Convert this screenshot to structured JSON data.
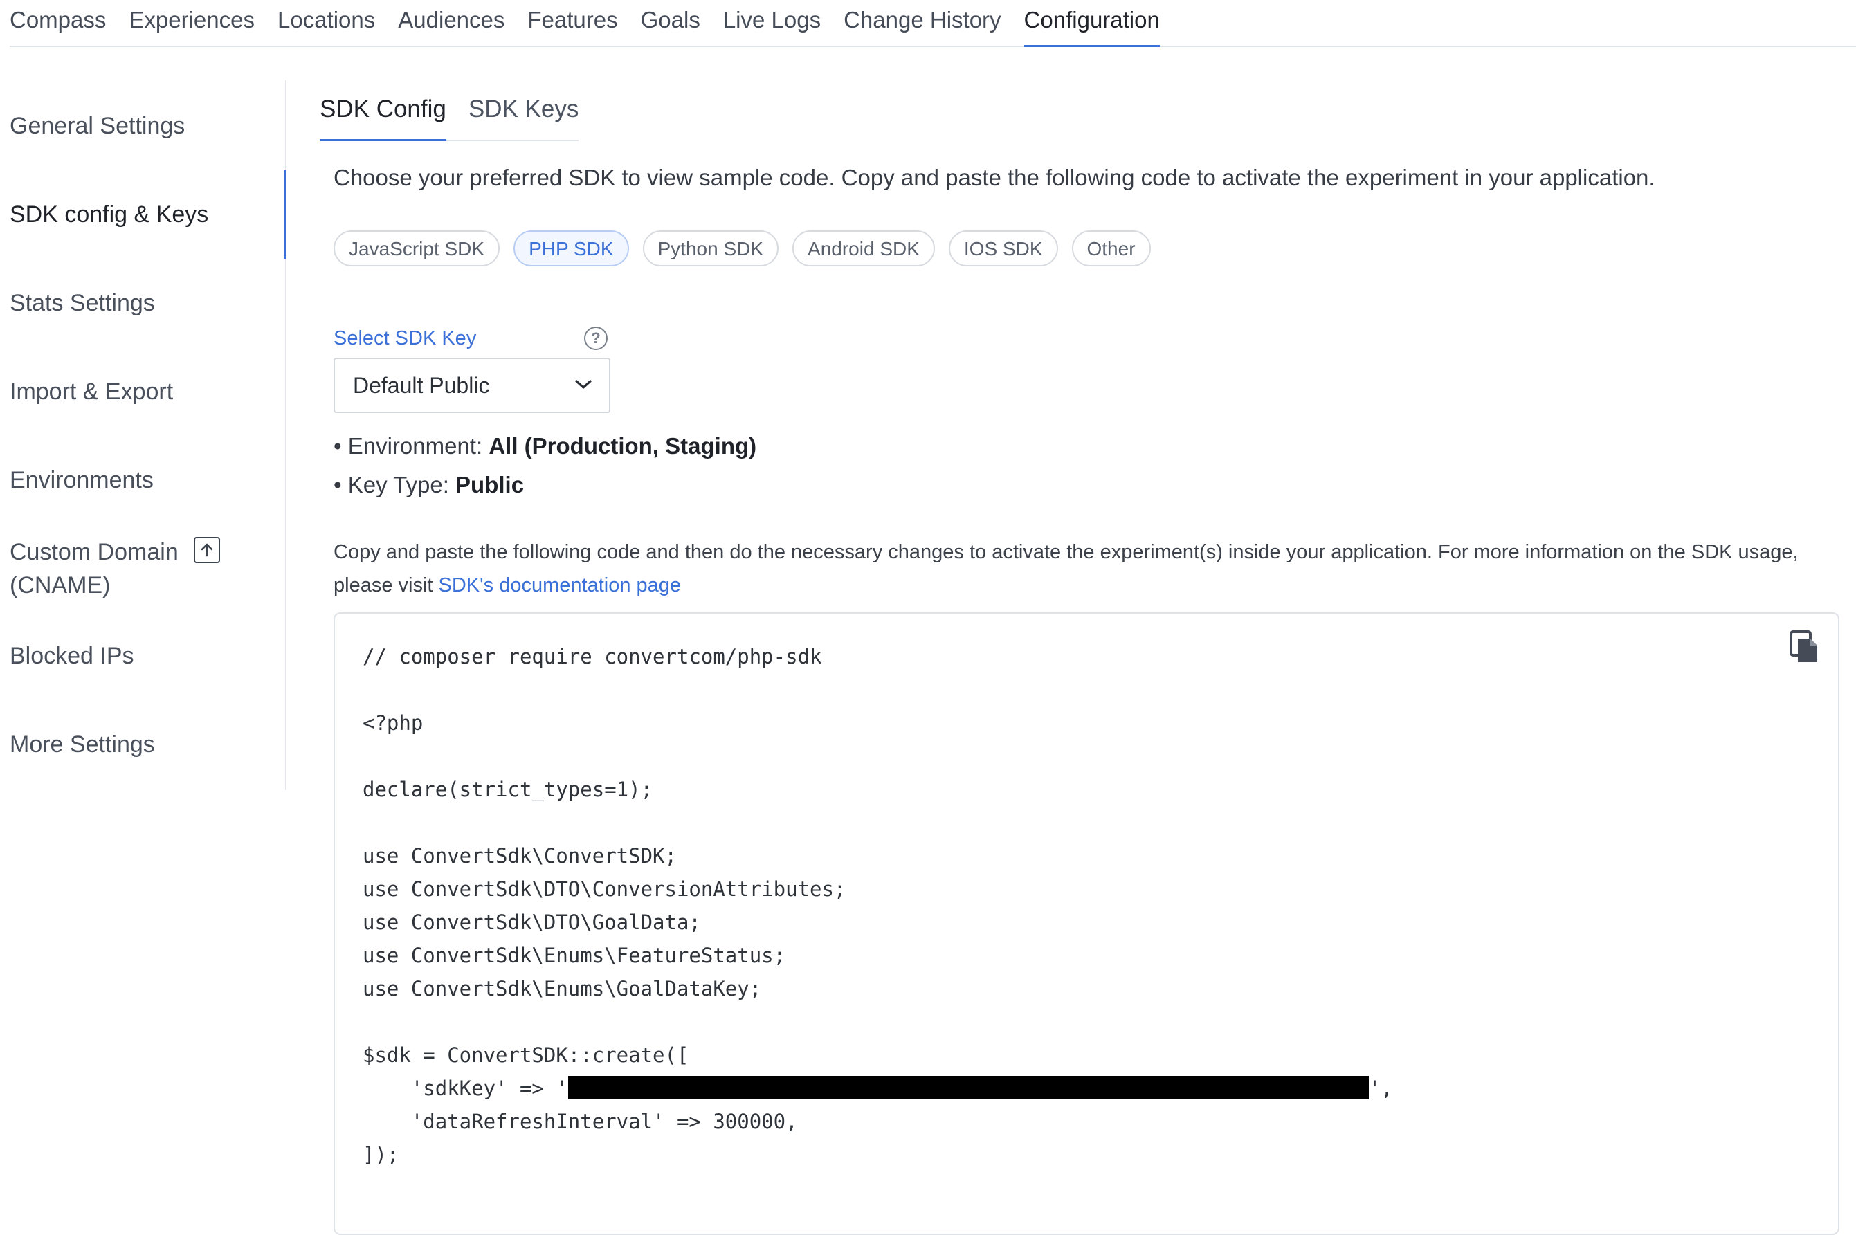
{
  "top_nav": {
    "items": [
      "Compass",
      "Experiences",
      "Locations",
      "Audiences",
      "Features",
      "Goals",
      "Live Logs",
      "Change History",
      "Configuration"
    ],
    "active": "Configuration"
  },
  "sidebar": {
    "items": [
      {
        "label": "General Settings"
      },
      {
        "label": "SDK config & Keys"
      },
      {
        "label": "Stats Settings"
      },
      {
        "label": "Import & Export"
      },
      {
        "label": "Environments"
      },
      {
        "label": "Custom Domain",
        "label_line2": "(CNAME)"
      },
      {
        "label": "Blocked IPs"
      },
      {
        "label": "More Settings"
      }
    ],
    "active": "SDK config & Keys"
  },
  "subtabs": {
    "sdk_config": "SDK Config",
    "sdk_keys": "SDK Keys",
    "active": "SDK Config"
  },
  "intro_text": "Choose your preferred SDK to view sample code. Copy and paste the following code to activate the experiment in your application.",
  "sdk_chips": [
    "JavaScript SDK",
    "PHP SDK",
    "Python SDK",
    "Android SDK",
    "IOS SDK",
    "Other"
  ],
  "selected_sdk": "PHP SDK",
  "select_sdk_key": {
    "label": "Select SDK Key",
    "value": "Default Public"
  },
  "key_info": {
    "environment_label": "• Environment: ",
    "environment_value": "All (Production, Staging)",
    "key_type_label": "• Key Type: ",
    "key_type_value": "Public"
  },
  "description": {
    "text": "Copy and paste the following code and then do the necessary changes to activate the experiment(s) inside your application. For more information on the SDK usage, please visit ",
    "link": "SDK's documentation page"
  },
  "code": {
    "line1": "// composer require convertcom/php-sdk",
    "line2": "",
    "line3": "<?php",
    "line4": "",
    "line5": "declare(strict_types=1);",
    "line6": "",
    "line7": "use ConvertSdk\\ConvertSDK;",
    "line8": "use ConvertSdk\\DTO\\ConversionAttributes;",
    "line9": "use ConvertSdk\\DTO\\GoalData;",
    "line10": "use ConvertSdk\\Enums\\FeatureStatus;",
    "line11": "use ConvertSdk\\Enums\\GoalDataKey;",
    "line12": "",
    "line13": "$sdk = ConvertSDK::create([",
    "line14_prefix": "    'sdkKey' => '",
    "line14_suffix": "',",
    "line15": "    'dataRefreshInterval' => 300000,",
    "line16": "]);"
  },
  "icons": {
    "copy": "copy-icon",
    "help": "help-circle-icon",
    "external": "external-upload-icon",
    "chevron": "chevron-down-icon"
  },
  "colors": {
    "accent": "#3a70d8",
    "text": "#2b2f36",
    "border": "#dfe2e6"
  }
}
